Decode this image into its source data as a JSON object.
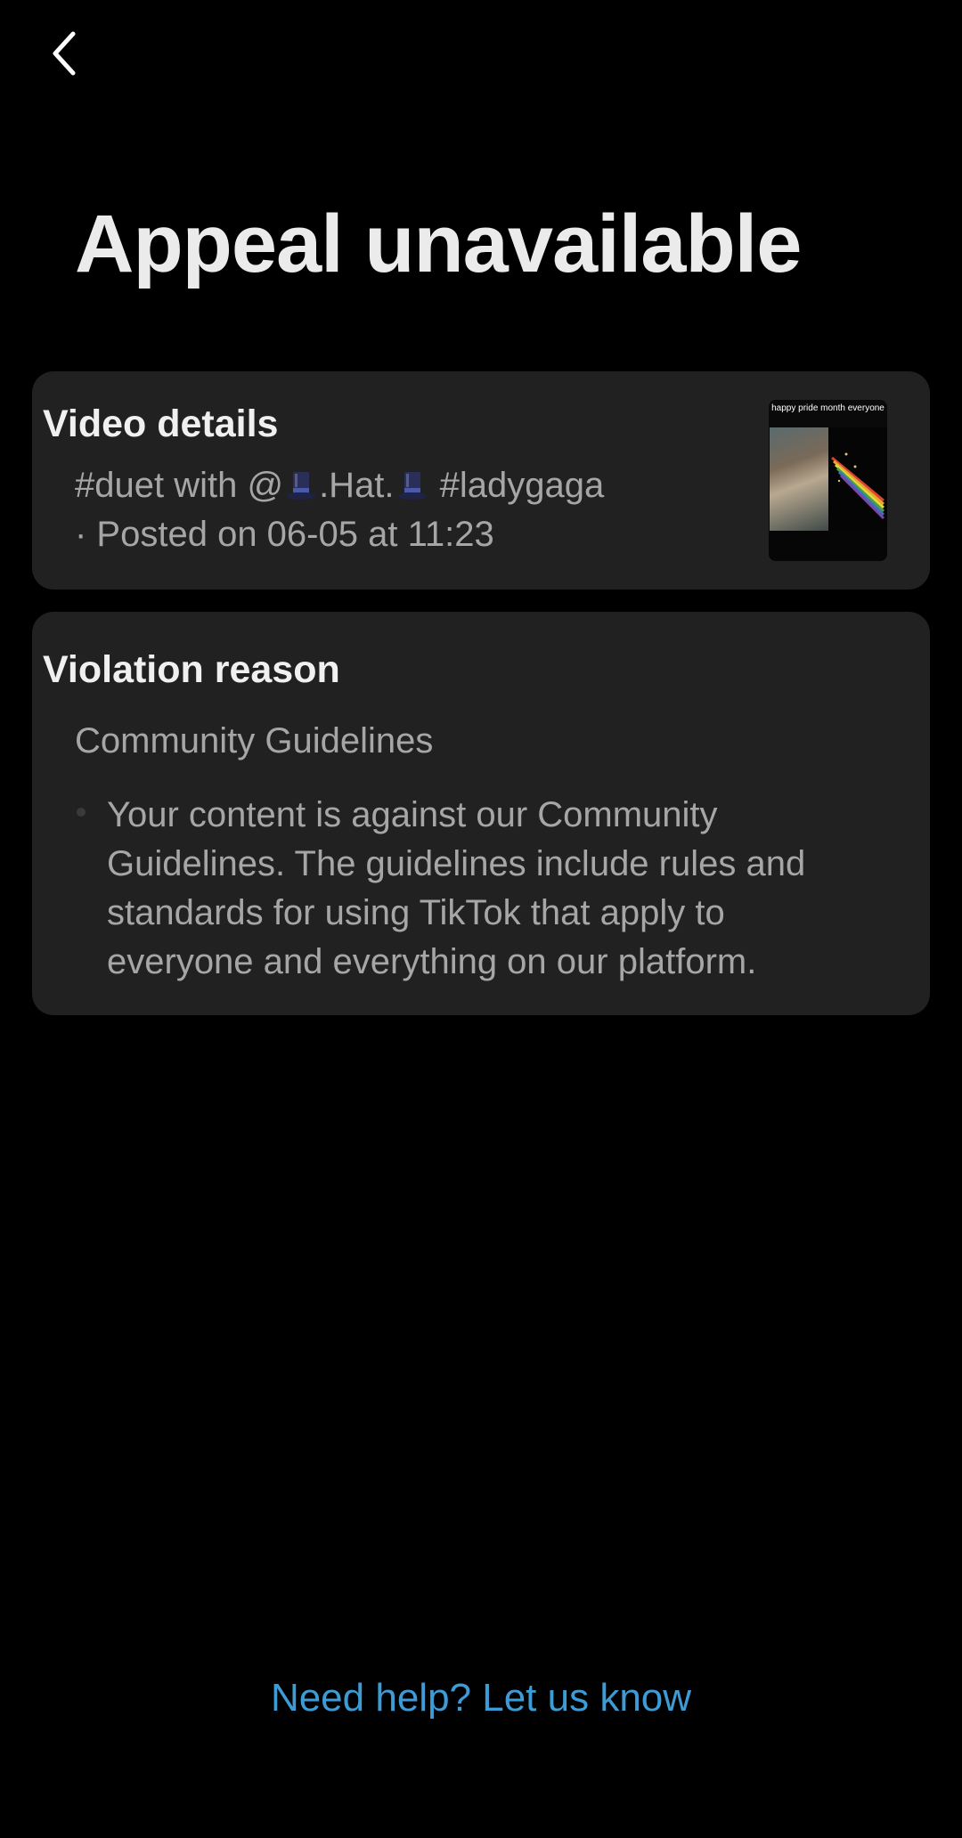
{
  "header": {
    "back_icon": "chevron-left-icon"
  },
  "page": {
    "title": "Appeal unavailable"
  },
  "video_details": {
    "heading": "Video details",
    "description_prefix": "#duet with @",
    "username_middle": ".Hat.",
    "hashtag": "#ladygaga",
    "posted_line": "· Posted on 06-05 at 11:23",
    "emoji_icon": "top-hat-icon",
    "thumbnail": {
      "caption": "happy pride month everyone"
    }
  },
  "violation": {
    "heading": "Violation reason",
    "category": "Community Guidelines",
    "description_lines": [
      "Your content is against our Community",
      "Guidelines. The guidelines include rules and",
      "standards for using TikTok that apply to",
      "everyone and everything on our platform."
    ]
  },
  "footer": {
    "help_link": "Need help? Let us know",
    "link_color": "#3d9bd6"
  },
  "colors": {
    "background": "#000000",
    "card": "#212121",
    "secondary_text": "#a6a6a6"
  }
}
